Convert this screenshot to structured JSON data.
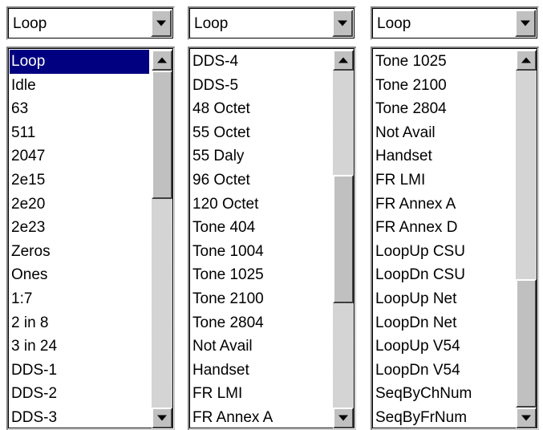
{
  "colors": {
    "selection": "#000080",
    "face": "#c0c0c0"
  },
  "icons": {
    "dropdown": "chevron-down-icon",
    "scroll_up": "arrow-up-icon",
    "scroll_down": "arrow-down-icon"
  },
  "selectors": [
    {
      "value": "Loop",
      "selected_index": 0,
      "scroll_position": 0.0,
      "items": [
        "Loop",
        "Idle",
        "63",
        "511",
        "2047",
        "2e15",
        "2e20",
        "2e23",
        "Zeros",
        "Ones",
        "1:7",
        "2 in 8",
        "3 in 24",
        "DDS-1",
        "DDS-2",
        "DDS-3"
      ]
    },
    {
      "value": "Loop",
      "selected_index": -1,
      "scroll_position": 0.5,
      "items": [
        "DDS-4",
        "DDS-5",
        "48 Octet",
        "55 Octet",
        "55 Daly",
        "96 Octet",
        "120 Octet",
        "Tone 404",
        "Tone 1004",
        "Tone 1025",
        "Tone 2100",
        "Tone 2804",
        "Not Avail",
        "Handset",
        "FR LMI",
        "FR Annex A"
      ]
    },
    {
      "value": "Loop",
      "selected_index": -1,
      "scroll_position": 1.0,
      "items": [
        "Tone 1025",
        "Tone 2100",
        "Tone 2804",
        "Not Avail",
        "Handset",
        "FR LMI",
        "FR Annex A",
        "FR Annex D",
        "LoopUp CSU",
        "LoopDn CSU",
        "LoopUp Net",
        "LoopDn Net",
        "LoopUp V54",
        "LoopDn V54",
        "SeqByChNum",
        "SeqByFrNum"
      ]
    }
  ]
}
